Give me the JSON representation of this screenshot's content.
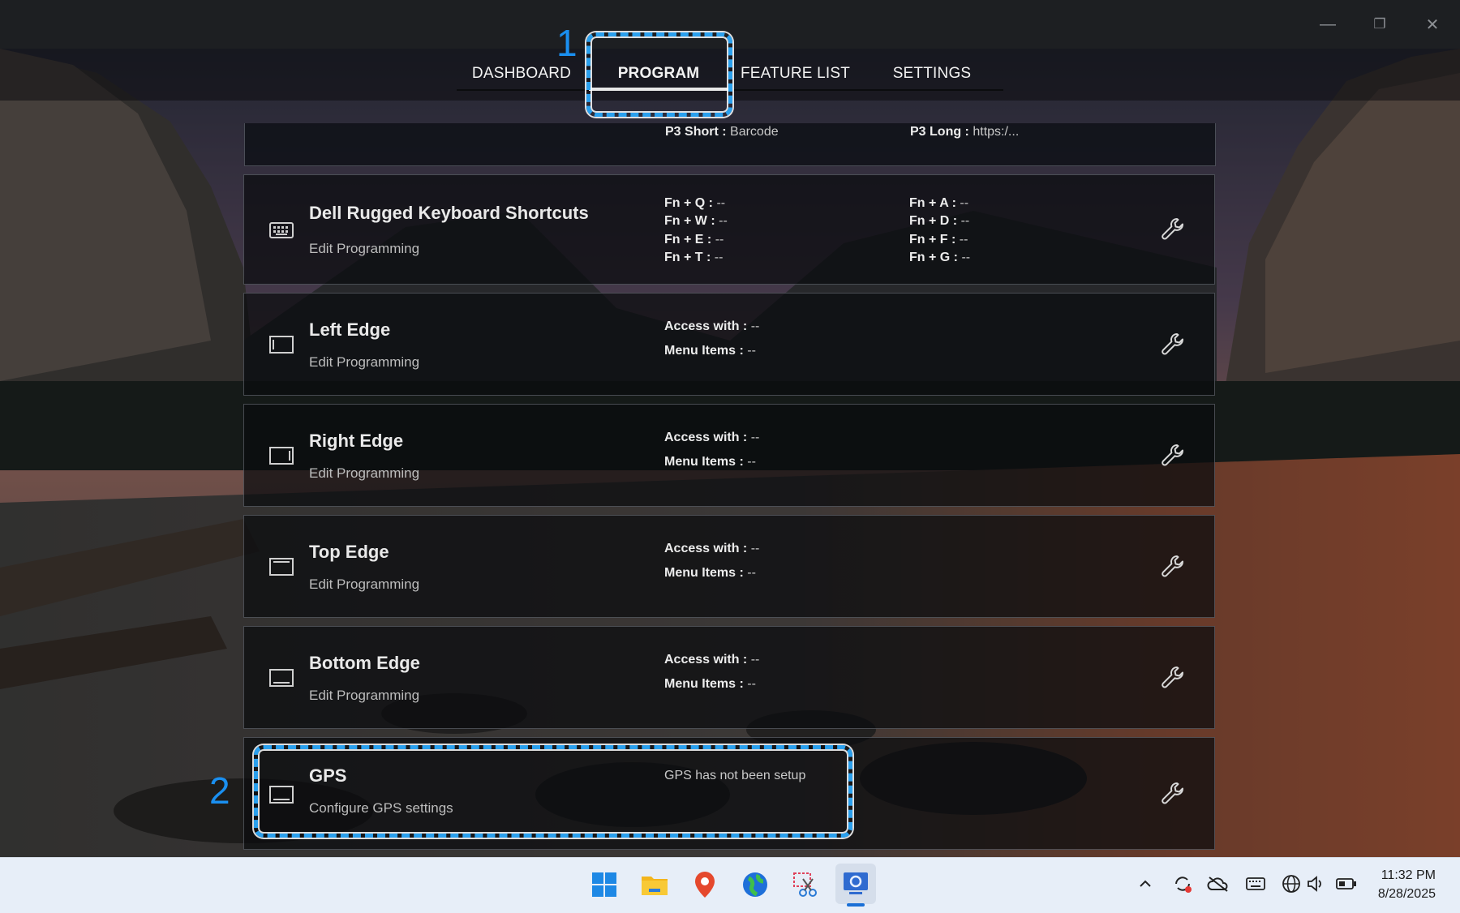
{
  "window": {
    "controls": {
      "minimize": "—",
      "restore": "❐",
      "close": "✕"
    }
  },
  "nav": {
    "tabs": [
      {
        "label": "DASHBOARD",
        "active": false
      },
      {
        "label": "PROGRAM",
        "active": true
      },
      {
        "label": "FEATURE LIST",
        "active": false
      },
      {
        "label": "SETTINGS",
        "active": false
      }
    ]
  },
  "partial_card": {
    "p3_short_label": "P3 Short :",
    "p3_short_value": "Barcode",
    "p3_long_label": "P3 Long :",
    "p3_long_value": "https:/..."
  },
  "cards": [
    {
      "title": "Dell Rugged Keyboard Shortcuts",
      "subtitle": "Edit Programming",
      "icon": "keyboard-icon",
      "left": [
        {
          "label": "Fn + Q :",
          "value": "--"
        },
        {
          "label": "Fn + W :",
          "value": "--"
        },
        {
          "label": "Fn + E :",
          "value": "--"
        },
        {
          "label": "Fn + T :",
          "value": "--"
        }
      ],
      "right": [
        {
          "label": "Fn + A :",
          "value": "--"
        },
        {
          "label": "Fn + D :",
          "value": "--"
        },
        {
          "label": "Fn + F :",
          "value": "--"
        },
        {
          "label": "Fn + G :",
          "value": "--"
        }
      ]
    },
    {
      "title": "Left Edge",
      "subtitle": "Edit Programming",
      "icon": "left-edge-icon",
      "access_label": "Access with :",
      "access_value": "--",
      "menu_label": "Menu Items :",
      "menu_value": "--"
    },
    {
      "title": "Right Edge",
      "subtitle": "Edit Programming",
      "icon": "right-edge-icon",
      "access_label": "Access with :",
      "access_value": "--",
      "menu_label": "Menu Items :",
      "menu_value": "--"
    },
    {
      "title": "Top Edge",
      "subtitle": "Edit Programming",
      "icon": "top-edge-icon",
      "access_label": "Access with :",
      "access_value": "--",
      "menu_label": "Menu Items :",
      "menu_value": "--"
    },
    {
      "title": "Bottom Edge",
      "subtitle": "Edit Programming",
      "icon": "bottom-edge-icon",
      "access_label": "Access with :",
      "access_value": "--",
      "menu_label": "Menu Items :",
      "menu_value": "--"
    },
    {
      "title": "GPS",
      "subtitle": "Configure GPS settings",
      "icon": "gps-icon",
      "status": "GPS has not been setup"
    }
  ],
  "annotations": {
    "step1": "1",
    "step2": "2",
    "color": "#2aa0ee"
  },
  "taskbar": {
    "apps": [
      "windows-start-icon",
      "file-explorer-icon",
      "maps-pin-icon",
      "globe-browser-icon",
      "snipping-tool-icon",
      "settings-app-icon"
    ],
    "tray": [
      "chevron-up-icon",
      "sync-icon",
      "onedrive-cloud-icon",
      "keyboard-icon",
      "network-globe-icon",
      "volume-icon",
      "battery-icon"
    ],
    "time": "11:32 PM",
    "date": "8/28/2025"
  }
}
